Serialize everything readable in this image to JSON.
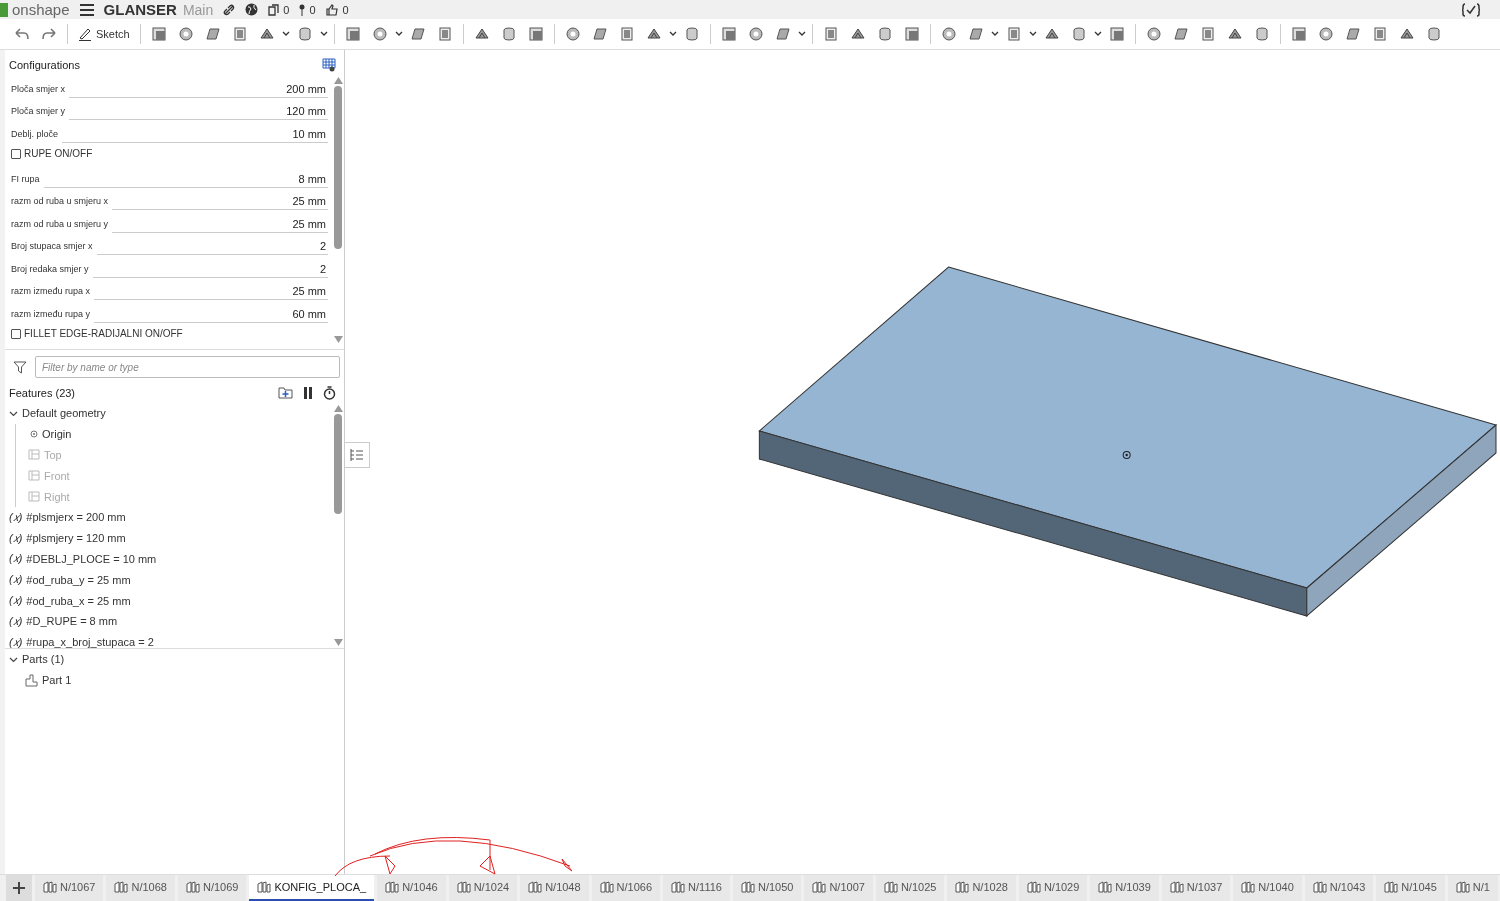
{
  "header": {
    "logo": "onshape",
    "document": "GLANSER",
    "branch": "Main",
    "counts": [
      "0",
      "0",
      "0"
    ]
  },
  "toolbar": {
    "sketch": "Sketch"
  },
  "configurations": {
    "title": "Configurations",
    "rows": [
      {
        "kind": "value",
        "label": "Ploča smjer x",
        "value": "200 mm"
      },
      {
        "kind": "value",
        "label": "Ploča smjer y",
        "value": "120 mm"
      },
      {
        "kind": "value",
        "label": "Deblj. ploče",
        "value": "10 mm"
      },
      {
        "kind": "checkbox",
        "label": "RUPE ON/OFF",
        "checked": false
      },
      {
        "kind": "value",
        "label": "FI rupa",
        "value": "8 mm"
      },
      {
        "kind": "value",
        "label": "razm od ruba u smjeru x",
        "value": "25 mm"
      },
      {
        "kind": "value",
        "label": "razm od ruba u smjeru y",
        "value": "25 mm"
      },
      {
        "kind": "value",
        "label": "Broj stupaca smjer x",
        "value": "2"
      },
      {
        "kind": "value",
        "label": "Broj redaka smjer y",
        "value": "2"
      },
      {
        "kind": "value",
        "label": "razm između rupa x",
        "value": "25 mm"
      },
      {
        "kind": "value",
        "label": "razm između rupa y",
        "value": "60 mm"
      },
      {
        "kind": "checkbox",
        "label": "FILLET EDGE-RADIJALNI ON/OFF",
        "checked": false
      }
    ]
  },
  "features": {
    "filter_placeholder": "Filter by name or type",
    "title": "Features (23)",
    "default_geometry": {
      "label": "Default geometry",
      "expanded": true,
      "children": [
        {
          "kind": "point",
          "label": "Origin"
        },
        {
          "kind": "plane",
          "label": "Top"
        },
        {
          "kind": "plane",
          "label": "Front"
        },
        {
          "kind": "plane",
          "label": "Right"
        }
      ]
    },
    "variables": [
      {
        "symbol": "(𝑥)",
        "label": "#plsmjerx = 200 mm"
      },
      {
        "symbol": "(𝑥)",
        "label": "#plsmjery = 120 mm"
      },
      {
        "symbol": "(𝑥)",
        "label": "#DEBLJ_PLOCE = 10 mm"
      },
      {
        "symbol": "(𝑥)",
        "label": "#od_ruba_y = 25 mm"
      },
      {
        "symbol": "(𝑥)",
        "label": "#od_ruba_x = 25 mm"
      },
      {
        "symbol": "(𝑥)",
        "label": "#D_RUPE = 8 mm"
      },
      {
        "symbol": "(𝑥)",
        "label": "#rupa_x_broj_stupaca = 2"
      }
    ],
    "parts": {
      "label": "Parts (1)",
      "expanded": true,
      "children": [
        {
          "label": "Part 1"
        }
      ]
    }
  },
  "tabs": [
    {
      "label": "N/1067",
      "selected": false
    },
    {
      "label": "N/1068",
      "selected": false
    },
    {
      "label": "N/1069",
      "selected": false
    },
    {
      "label": "KONFIG_PLOCA_",
      "selected": true
    },
    {
      "label": "N/1046",
      "selected": false
    },
    {
      "label": "N/1024",
      "selected": false
    },
    {
      "label": "N/1048",
      "selected": false
    },
    {
      "label": "N/1066",
      "selected": false
    },
    {
      "label": "N/1116",
      "selected": false
    },
    {
      "label": "N/1050",
      "selected": false
    },
    {
      "label": "N/1007",
      "selected": false
    },
    {
      "label": "N/1025",
      "selected": false
    },
    {
      "label": "N/1028",
      "selected": false
    },
    {
      "label": "N/1029",
      "selected": false
    },
    {
      "label": "N/1039",
      "selected": false
    },
    {
      "label": "N/1037",
      "selected": false
    },
    {
      "label": "N/1040",
      "selected": false
    },
    {
      "label": "N/1043",
      "selected": false
    },
    {
      "label": "N/1045",
      "selected": false
    },
    {
      "label": "N/1",
      "selected": false
    }
  ]
}
